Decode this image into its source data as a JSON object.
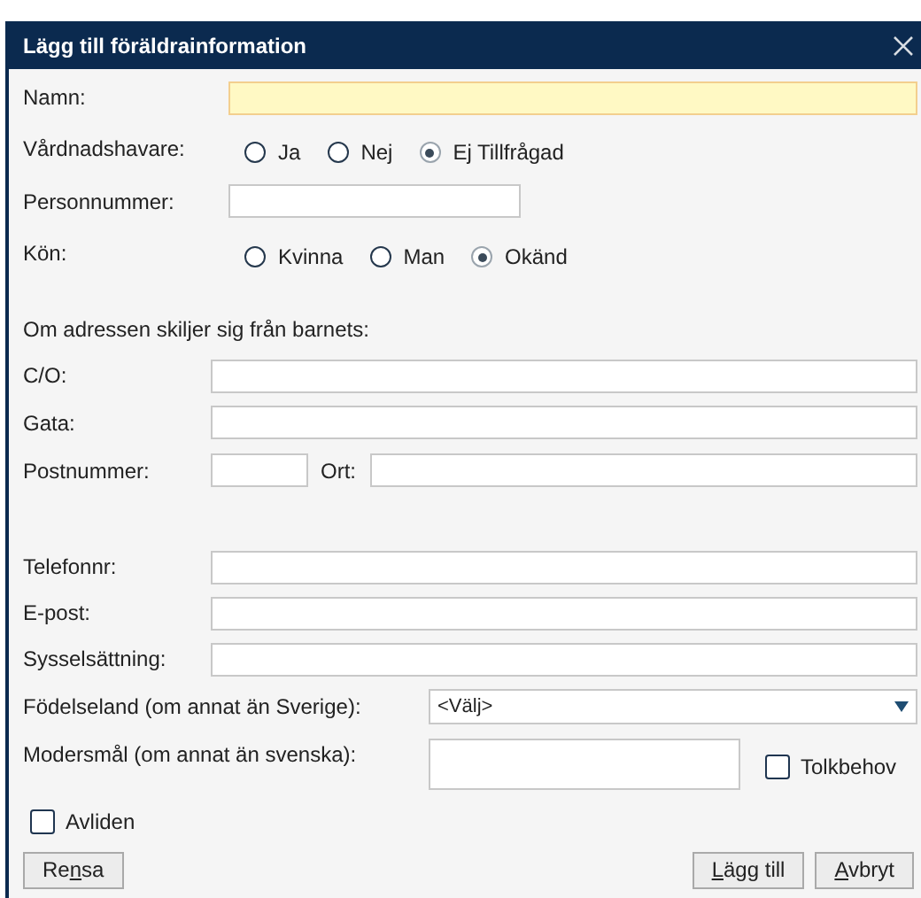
{
  "window": {
    "title": "Lägg till föräldrainformation"
  },
  "name_field": {
    "label": "Namn:",
    "required": true
  },
  "guardian": {
    "label": "Vårdnadshavare:",
    "options": [
      {
        "label": "Ja",
        "selected": false
      },
      {
        "label": "Nej",
        "selected": false
      },
      {
        "label": "Ej Tillfrågad",
        "selected": true
      }
    ]
  },
  "personal_number": {
    "label": "Personnummer:"
  },
  "gender": {
    "label": "Kön:",
    "options": [
      {
        "label": "Kvinna",
        "selected": false
      },
      {
        "label": "Man",
        "selected": false
      },
      {
        "label": "Okänd",
        "selected": true
      }
    ]
  },
  "address": {
    "heading": "Om adressen skiljer sig från barnets:",
    "co": {
      "label": "C/O:"
    },
    "street": {
      "label": "Gata:"
    },
    "postal_code": {
      "label": "Postnummer:"
    },
    "city": {
      "label": "Ort:"
    }
  },
  "contact": [
    {
      "label": "Telefonnr:"
    },
    {
      "label": "E-post:"
    },
    {
      "label": "Sysselsättning:"
    }
  ],
  "birth_country": {
    "label": "Födelseland (om annat än Sverige):",
    "value": "<Välj>"
  },
  "mother_tongue": {
    "label": "Modersmål (om annat än svenska):"
  },
  "interpreter": {
    "label": "Tolkbehov",
    "checked": false
  },
  "deceased": {
    "label": "Avliden",
    "checked": false
  },
  "left_buttons": [
    {
      "pre": "Re",
      "key": "n",
      "post": "sa"
    }
  ],
  "right_buttons": [
    {
      "key": "L",
      "post": "ägg till"
    },
    {
      "key": "A",
      "post": "vbryt"
    }
  ]
}
